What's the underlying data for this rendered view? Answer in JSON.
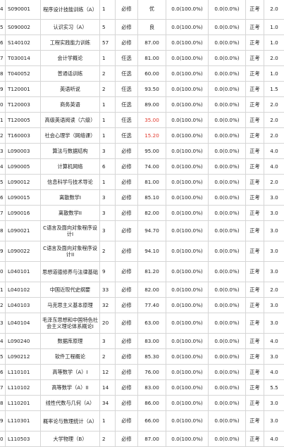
{
  "rows": [
    {
      "idx": "4",
      "code": "S090001",
      "name": "程序设计技能训练（A）",
      "seq": "1",
      "type": "必修",
      "score": "优",
      "r1": "0.0(100.0%)",
      "r2": "0.0(0.0%)",
      "exam": "正考",
      "credit": "2.0"
    },
    {
      "idx": "5",
      "code": "S090002",
      "name": "认识实习（A）",
      "seq": "5",
      "type": "必修",
      "score": "良",
      "r1": "0.0(100.0%)",
      "r2": "0.0(0.0%)",
      "exam": "正考",
      "credit": "1.0"
    },
    {
      "idx": "6",
      "code": "S140102",
      "name": "工程实践能力训练",
      "seq": "57",
      "type": "必修",
      "score": "87.00",
      "r1": "0.0(100.0%)",
      "r2": "0.0(0.0%)",
      "exam": "正考",
      "credit": "1.0"
    },
    {
      "idx": "7",
      "code": "T030014",
      "name": "会计学概论",
      "seq": "1",
      "type": "任选",
      "score": "81.00",
      "r1": "0.0(100.0%)",
      "r2": "0.0(0.0%)",
      "exam": "正考",
      "credit": "2.0"
    },
    {
      "idx": "8",
      "code": "T040052",
      "name": "普通话训练",
      "seq": "2",
      "type": "任选",
      "score": "60.00",
      "r1": "0.0(100.0%)",
      "r2": "0.0(0.0%)",
      "exam": "正考",
      "credit": "1.0"
    },
    {
      "idx": "9",
      "code": "T120001",
      "name": "英语听说",
      "seq": "2",
      "type": "任选",
      "score": "93.50",
      "r1": "0.0(100.0%)",
      "r2": "0.0(0.0%)",
      "exam": "正考",
      "credit": "1.5"
    },
    {
      "idx": "0",
      "code": "T120003",
      "name": "商务英语",
      "seq": "1",
      "type": "任选",
      "score": "89.00",
      "r1": "0.0(100.0%)",
      "r2": "0.0(0.0%)",
      "exam": "正考",
      "credit": "2.0"
    },
    {
      "idx": "1",
      "code": "T120005",
      "name": "高级英语阅读（六级）",
      "seq": "1",
      "type": "任选",
      "score": "35.00",
      "fail": true,
      "r1": "0.0(100.0%)",
      "r2": "0.0(0.0%)",
      "exam": "正考",
      "credit": "2.0"
    },
    {
      "idx": "2",
      "code": "T160003",
      "name": "社会心理学（网络课）",
      "seq": "1",
      "type": "任选",
      "score": "15.20",
      "fail": true,
      "r1": "0.0(100.0%)",
      "r2": "0.0(0.0%)",
      "exam": "正考",
      "credit": "2.0"
    },
    {
      "idx": "3",
      "code": "L090003",
      "name": "算法与数据结构",
      "seq": "3",
      "type": "必修",
      "score": "95.00",
      "r1": "0.0(100.0%)",
      "r2": "0.0(0.0%)",
      "exam": "正考",
      "credit": "4.0"
    },
    {
      "idx": "4",
      "code": "L090005",
      "name": "计算机网络",
      "seq": "6",
      "type": "必修",
      "score": "74.00",
      "r1": "0.0(100.0%)",
      "r2": "0.0(0.0%)",
      "exam": "正考",
      "credit": "4.0"
    },
    {
      "idx": "5",
      "code": "L090012",
      "name": "信息科学与技术导论",
      "seq": "1",
      "type": "必修",
      "score": "81.00",
      "r1": "0.0(100.0%)",
      "r2": "0.0(0.0%)",
      "exam": "正考",
      "credit": "2.0"
    },
    {
      "idx": "6",
      "code": "L090015",
      "name": "离散数学I",
      "seq": "3",
      "type": "必修",
      "score": "85.10",
      "r1": "0.0(100.0%)",
      "r2": "0.0(0.0%)",
      "exam": "正考",
      "credit": "3.0"
    },
    {
      "idx": "7",
      "code": "L090016",
      "name": "离散数学II",
      "seq": "3",
      "type": "必修",
      "score": "82.00",
      "r1": "0.0(100.0%)",
      "r2": "0.0(0.0%)",
      "exam": "正考",
      "credit": "3.0"
    },
    {
      "idx": "8",
      "code": "L090021",
      "name": "C语言及面向对象程序设计I",
      "seq": "3",
      "type": "必修",
      "score": "94.70",
      "r1": "0.0(100.0%)",
      "r2": "0.0(0.0%)",
      "exam": "正考",
      "credit": "3.0"
    },
    {
      "idx": "9",
      "code": "L090022",
      "name": "C语言及面向对象程序设计II",
      "seq": "2",
      "type": "必修",
      "score": "94.10",
      "r1": "0.0(100.0%)",
      "r2": "0.0(0.0%)",
      "exam": "正考",
      "credit": "3.0"
    },
    {
      "idx": "0",
      "code": "L040101",
      "name": "思想道德修养与法律基础",
      "seq": "9",
      "type": "必修",
      "score": "81.20",
      "r1": "0.0(100.0%)",
      "r2": "0.0(0.0%)",
      "exam": "正考",
      "credit": "3.0"
    },
    {
      "idx": "1",
      "code": "L040102",
      "name": "中国近现代史纲要",
      "seq": "33",
      "type": "必修",
      "score": "82.00",
      "r1": "0.0(100.0%)",
      "r2": "0.0(0.0%)",
      "exam": "正考",
      "credit": "2.0"
    },
    {
      "idx": "2",
      "code": "L040103",
      "name": "马克思主义基本原理",
      "seq": "32",
      "type": "必修",
      "score": "77.40",
      "r1": "0.0(100.0%)",
      "r2": "0.0(0.0%)",
      "exam": "正考",
      "credit": "3.0"
    },
    {
      "idx": "3",
      "code": "L040104",
      "name": "毛泽东思想和中国特色社会主义理论体系概论I",
      "seq": "20",
      "type": "必修",
      "score": "63.00",
      "r1": "0.0(100.0%)",
      "r2": "0.0(0.0%)",
      "exam": "正考",
      "credit": "3.0"
    },
    {
      "idx": "4",
      "code": "L090240",
      "name": "数据库原理",
      "seq": "3",
      "type": "必修",
      "score": "83.00",
      "r1": "0.0(100.0%)",
      "r2": "0.0(0.0%)",
      "exam": "正考",
      "credit": "4.0"
    },
    {
      "idx": "5",
      "code": "L090212",
      "name": "软件工程概论",
      "seq": "2",
      "type": "必修",
      "score": "85.30",
      "r1": "0.0(100.0%)",
      "r2": "0.0(0.0%)",
      "exam": "正考",
      "credit": "3.0"
    },
    {
      "idx": "6",
      "code": "L110101",
      "name": "高等数学（A）I",
      "seq": "12",
      "type": "必修",
      "score": "76.00",
      "r1": "0.0(100.0%)",
      "r2": "0.0(0.0%)",
      "exam": "正考",
      "credit": "4.0"
    },
    {
      "idx": "7",
      "code": "L110102",
      "name": "高等数学（A）II",
      "seq": "14",
      "type": "必修",
      "score": "83.00",
      "r1": "0.0(100.0%)",
      "r2": "0.0(0.0%)",
      "exam": "正考",
      "credit": "5.5"
    },
    {
      "idx": "8",
      "code": "L110201",
      "name": "线性代数与几何（A）",
      "seq": "34",
      "type": "必修",
      "score": "86.00",
      "r1": "0.0(100.0%)",
      "r2": "0.0(0.0%)",
      "exam": "正考",
      "credit": "3.0"
    },
    {
      "idx": "9",
      "code": "L110301",
      "name": "概率论与数理统计（A）",
      "seq": "1",
      "type": "必修",
      "score": "66.00",
      "r1": "0.0(100.0%)",
      "r2": "0.0(0.0%)",
      "exam": "正考",
      "credit": "3.0"
    },
    {
      "idx": "0",
      "code": "L110503",
      "name": "大学物理（B）",
      "seq": "2",
      "type": "必修",
      "score": "87.00",
      "r1": "0.0(100.0%)",
      "r2": "0.0(0.0%)",
      "exam": "正考",
      "credit": "4.0"
    }
  ]
}
